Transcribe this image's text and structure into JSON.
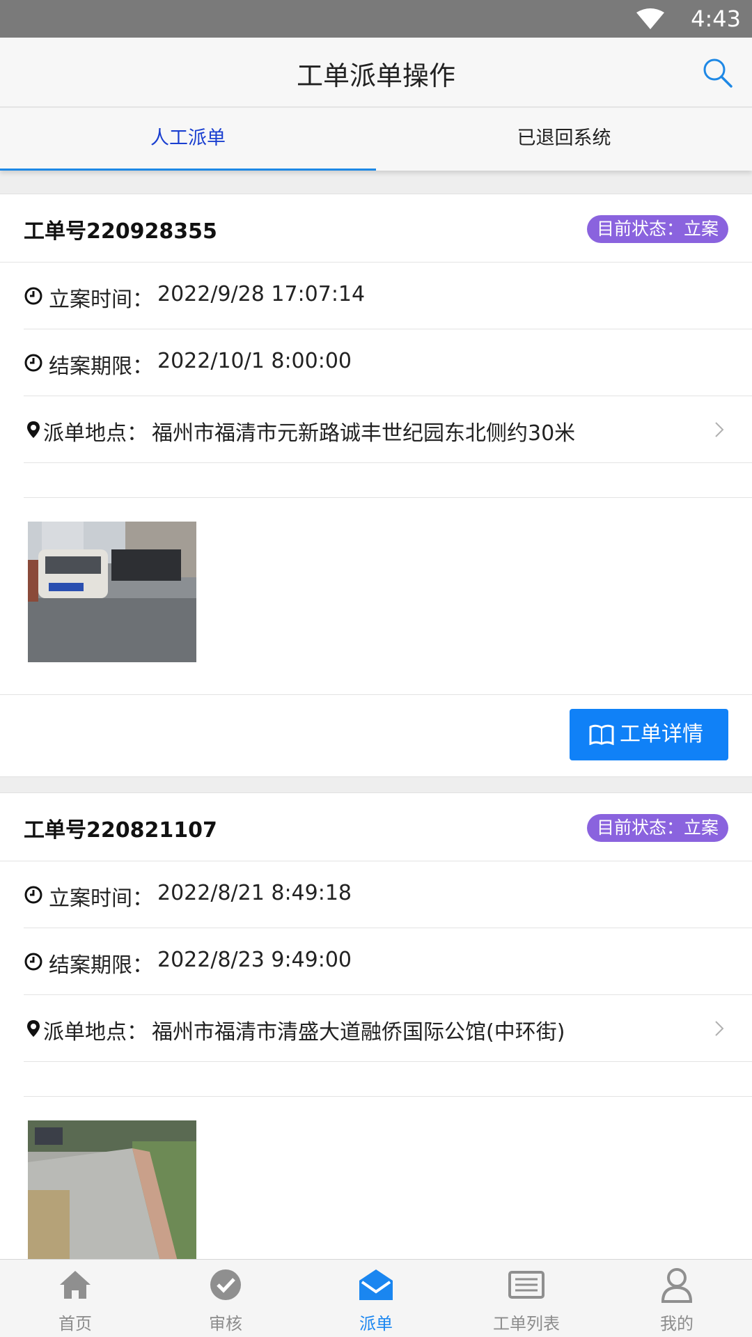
{
  "status_bar": {
    "time": "4:43"
  },
  "header": {
    "title": "工单派单操作"
  },
  "tabs": [
    {
      "label": "人工派单",
      "active": true
    },
    {
      "label": "已退回系统",
      "active": false
    }
  ],
  "orders": [
    {
      "order_no": "工单号220928355",
      "status": "目前状态：立案",
      "filed_label": "立案时间：",
      "filed_value": "2022/9/28 17:07:14",
      "deadline_label": "结案期限：",
      "deadline_value": "2022/10/1 8:00:00",
      "location_label": "派单地点：",
      "location_value": "福州市福清市元新路诚丰世纪园东北侧约30米",
      "detail_button": "工单详情"
    },
    {
      "order_no": "工单号220821107",
      "status": "目前状态：立案",
      "filed_label": "立案时间：",
      "filed_value": "2022/8/21 8:49:18",
      "deadline_label": "结案期限：",
      "deadline_value": "2022/8/23 9:49:00",
      "location_label": "派单地点：",
      "location_value": "福州市福清市清盛大道融侨国际公馆(中环街)"
    }
  ],
  "bottom_nav": [
    {
      "label": "首页",
      "icon": "home-icon"
    },
    {
      "label": "审核",
      "icon": "check-circle-icon"
    },
    {
      "label": "派单",
      "icon": "dispatch-envelope-icon",
      "active": true
    },
    {
      "label": "工单列表",
      "icon": "list-icon"
    },
    {
      "label": "我的",
      "icon": "user-icon"
    }
  ],
  "colors": {
    "accent": "#1081f7",
    "badge": "#8a63de",
    "tab_active_text": "#1a3fd0",
    "nav_active": "#1a86f0"
  }
}
